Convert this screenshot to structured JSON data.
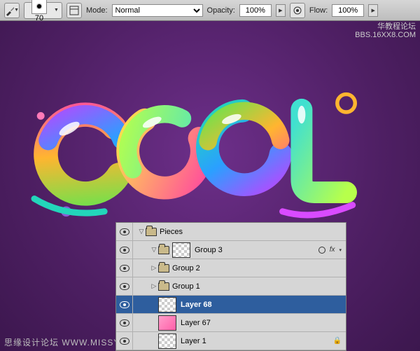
{
  "toolbar": {
    "brush_size": "70",
    "mode_label": "Mode:",
    "mode_value": "Normal",
    "opacity_label": "Opacity:",
    "opacity_value": "100%",
    "flow_label": "Flow:",
    "flow_value": "100%"
  },
  "canvas": {
    "artwork_text": "COOL",
    "watermark_footer": "思缘设计论坛  WWW.MISSYUAN.COM",
    "watermark_top_line1": "华教程论坛",
    "watermark_top_line2": "BBS.16XX8.COM"
  },
  "layers": {
    "items": [
      {
        "kind": "group",
        "name": "Pieces",
        "indent": 0,
        "expanded": true,
        "selected": false,
        "extras": "none"
      },
      {
        "kind": "group",
        "name": "Group 3",
        "indent": 1,
        "expanded": true,
        "selected": false,
        "extras": "fx"
      },
      {
        "kind": "group",
        "name": "Group 2",
        "indent": 1,
        "expanded": false,
        "selected": false,
        "extras": "none"
      },
      {
        "kind": "group",
        "name": "Group 1",
        "indent": 1,
        "expanded": false,
        "selected": false,
        "extras": "none"
      },
      {
        "kind": "layer",
        "name": "Layer 68",
        "indent": 1,
        "thumb": "checker",
        "selected": true,
        "extras": "none"
      },
      {
        "kind": "layer",
        "name": "Layer 67",
        "indent": 1,
        "thumb": "pink",
        "selected": false,
        "extras": "none"
      },
      {
        "kind": "layer",
        "name": "Layer 1",
        "indent": 1,
        "thumb": "checker",
        "selected": false,
        "extras": "lock"
      }
    ]
  },
  "colors": {
    "accent": "#2e5e9e",
    "canvas_bg": "#4e1f63"
  }
}
